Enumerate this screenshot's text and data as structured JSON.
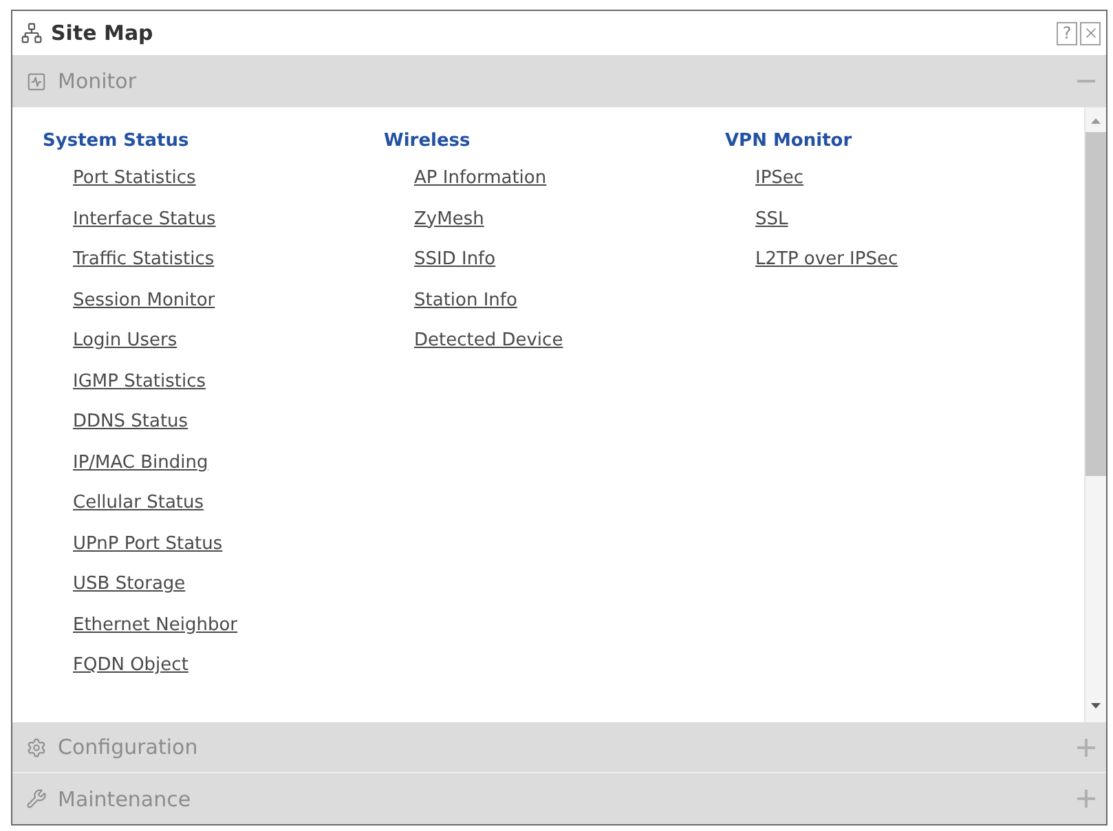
{
  "window": {
    "title": "Site Map",
    "help_button": "?"
  },
  "sections": [
    {
      "title": "Monitor",
      "expanded": true,
      "groups": [
        {
          "title": "System Status",
          "links": [
            "Port Statistics",
            "Interface Status",
            "Traffic Statistics",
            "Session Monitor",
            "Login Users",
            "IGMP Statistics",
            "DDNS Status",
            "IP/MAC Binding",
            "Cellular Status",
            "UPnP Port Status",
            "USB Storage",
            "Ethernet Neighbor",
            "FQDN Object"
          ]
        },
        {
          "title": "Wireless",
          "links": [
            "AP Information",
            "ZyMesh",
            "SSID Info",
            "Station Info",
            "Detected Device"
          ]
        },
        {
          "title": "VPN Monitor",
          "links": [
            "IPSec",
            "SSL",
            "L2TP over IPSec"
          ]
        }
      ]
    },
    {
      "title": "Configuration",
      "expanded": false
    },
    {
      "title": "Maintenance",
      "expanded": false
    }
  ]
}
